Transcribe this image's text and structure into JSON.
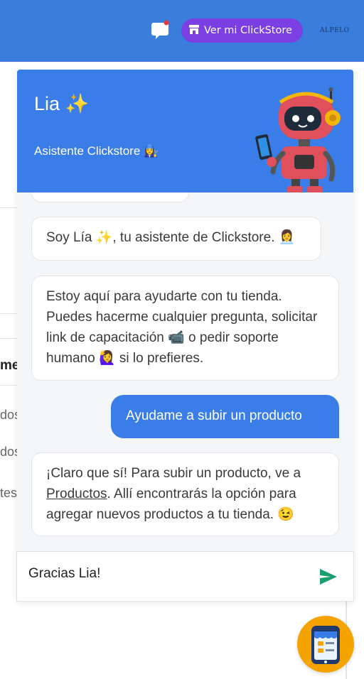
{
  "topbar": {
    "store_button_label": "Ver mi ClickStore",
    "brand_text": "ALPELO",
    "notification_color": "#e53935"
  },
  "background": {
    "fragments": [
      "me",
      "dos",
      "dos",
      "tes"
    ]
  },
  "widget": {
    "title": "Lia ✨",
    "subtitle": "Asistente Clickstore 👩‍🔧",
    "messages": [
      {
        "from": "bot",
        "text": "Soy Lía ✨, tu asistente de Clickstore. 👩‍💼"
      },
      {
        "from": "bot",
        "text": "Estoy aquí para ayudarte con tu tienda. Puedes hacerme cualquier pregunta, solicitar link de capacitación 📹 o pedir soporte humano 🙋‍♀️ si lo prefieres."
      },
      {
        "from": "user",
        "text": "Ayudame a subir un producto"
      },
      {
        "from": "bot",
        "text_before": "¡Claro que sí! Para subir un producto, ve a ",
        "link": "Productos",
        "text_after": ". Allí encontrarás la opción para agregar nuevos productos a tu tienda. 😉"
      }
    ],
    "composer_value": "Gracias Lia!"
  },
  "colors": {
    "topbar": "#3b7ddd",
    "accent_purple": "#7b3fe4",
    "widget_header": "#3a7de8",
    "send_icon": "#1a9e6e",
    "fab": "#f5a300"
  },
  "icons": [
    "chat-bubble-icon",
    "store-icon",
    "robot-mascot",
    "send-icon",
    "store-fab-icon"
  ]
}
